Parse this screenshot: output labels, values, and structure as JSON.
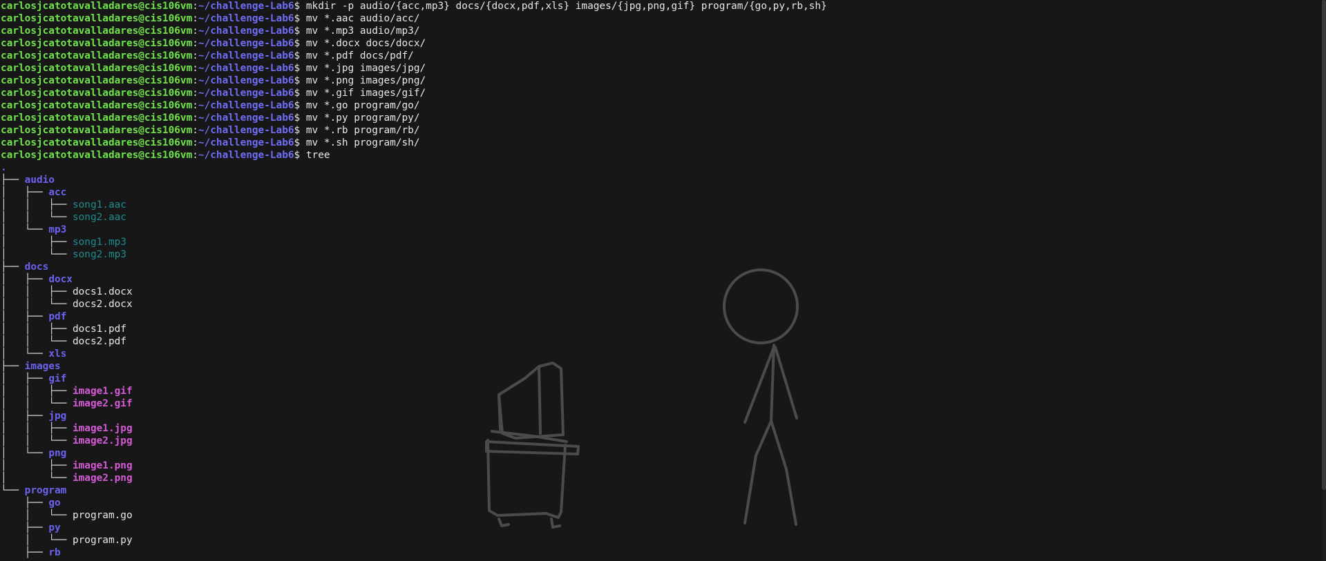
{
  "prompt": {
    "user": "carlosjcatotavalladares@cis106vm",
    "separator": ":",
    "path": "~/challenge-Lab6",
    "dollar": "$"
  },
  "commands": [
    "mkdir -p audio/{acc,mp3} docs/{docx,pdf,xls} images/{jpg,png,gif} program/{go,py,rb,sh}",
    "mv *.aac audio/acc/",
    "mv *.mp3 audio/mp3/",
    "mv *.docx docs/docx/",
    "mv *.pdf docs/pdf/",
    "mv *.jpg images/jpg/",
    "mv *.png images/png/",
    "mv *.gif images/gif/",
    "mv *.go program/go/",
    "mv *.py program/py/",
    "mv *.rb program/rb/",
    "mv *.sh program/sh/",
    "tree"
  ],
  "tree": {
    "root": ".",
    "lines": [
      {
        "prefix": "├── ",
        "name": "audio",
        "kind": "dir"
      },
      {
        "prefix": "│   ├── ",
        "name": "acc",
        "kind": "dir"
      },
      {
        "prefix": "│   │   ├── ",
        "name": "song1.aac",
        "kind": "audio"
      },
      {
        "prefix": "│   │   └── ",
        "name": "song2.aac",
        "kind": "audio"
      },
      {
        "prefix": "│   └── ",
        "name": "mp3",
        "kind": "dir"
      },
      {
        "prefix": "│       ├── ",
        "name": "song1.mp3",
        "kind": "audio"
      },
      {
        "prefix": "│       └── ",
        "name": "song2.mp3",
        "kind": "audio"
      },
      {
        "prefix": "├── ",
        "name": "docs",
        "kind": "dir"
      },
      {
        "prefix": "│   ├── ",
        "name": "docx",
        "kind": "dir"
      },
      {
        "prefix": "│   │   ├── ",
        "name": "docs1.docx",
        "kind": "doc"
      },
      {
        "prefix": "│   │   └── ",
        "name": "docs2.docx",
        "kind": "doc"
      },
      {
        "prefix": "│   ├── ",
        "name": "pdf",
        "kind": "dir"
      },
      {
        "prefix": "│   │   ├── ",
        "name": "docs1.pdf",
        "kind": "doc"
      },
      {
        "prefix": "│   │   └── ",
        "name": "docs2.pdf",
        "kind": "doc"
      },
      {
        "prefix": "│   └── ",
        "name": "xls",
        "kind": "dir"
      },
      {
        "prefix": "├── ",
        "name": "images",
        "kind": "dir"
      },
      {
        "prefix": "│   ├── ",
        "name": "gif",
        "kind": "dir"
      },
      {
        "prefix": "│   │   ├── ",
        "name": "image1.gif",
        "kind": "img"
      },
      {
        "prefix": "│   │   └── ",
        "name": "image2.gif",
        "kind": "img"
      },
      {
        "prefix": "│   ├── ",
        "name": "jpg",
        "kind": "dir"
      },
      {
        "prefix": "│   │   ├── ",
        "name": "image1.jpg",
        "kind": "img"
      },
      {
        "prefix": "│   │   └── ",
        "name": "image2.jpg",
        "kind": "img"
      },
      {
        "prefix": "│   └── ",
        "name": "png",
        "kind": "dir"
      },
      {
        "prefix": "│       ├── ",
        "name": "image1.png",
        "kind": "img"
      },
      {
        "prefix": "│       └── ",
        "name": "image2.png",
        "kind": "img"
      },
      {
        "prefix": "└── ",
        "name": "program",
        "kind": "dir"
      },
      {
        "prefix": "    ├── ",
        "name": "go",
        "kind": "dir"
      },
      {
        "prefix": "    │   └── ",
        "name": "program.go",
        "kind": "doc"
      },
      {
        "prefix": "    ├── ",
        "name": "py",
        "kind": "dir"
      },
      {
        "prefix": "    │   └── ",
        "name": "program.py",
        "kind": "doc"
      },
      {
        "prefix": "    ├── ",
        "name": "rb",
        "kind": "dir"
      }
    ]
  },
  "colors": {
    "background": "#171717",
    "user": "#6fe44a",
    "path": "#6f6df5",
    "dir": "#6b63f0",
    "audio": "#1e8b8f",
    "image": "#d65ad6",
    "wallpaper_lines": "#4a4a4a"
  }
}
